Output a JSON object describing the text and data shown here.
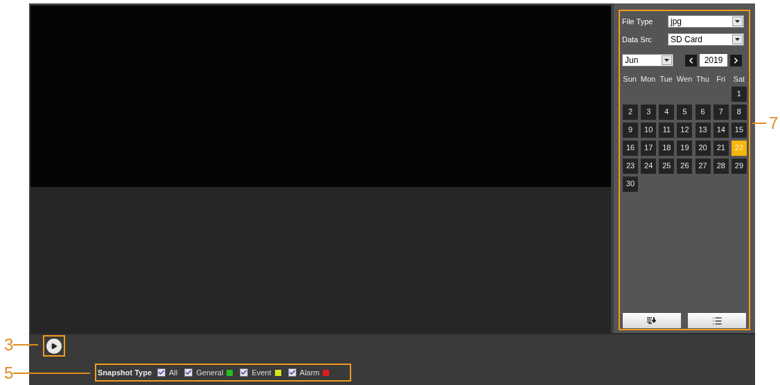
{
  "player": {
    "callout": "3"
  },
  "snapshot_filter": {
    "callout": "5",
    "label": "Snapshot Type",
    "types": [
      {
        "label": "All",
        "checked": true
      },
      {
        "label": "General",
        "checked": true,
        "color": "#22c021"
      },
      {
        "label": "Event",
        "checked": true,
        "color": "#d6e81c"
      },
      {
        "label": "Alarm",
        "checked": true,
        "color": "#e21b1b"
      }
    ]
  },
  "side_panel": {
    "callout": "7",
    "fields": [
      {
        "label": "File Type",
        "value": "jpg"
      },
      {
        "label": "Data Src",
        "value": "SD Card"
      }
    ],
    "month": "Jun",
    "year": "2019",
    "weekdays": [
      "Sun",
      "Mon",
      "Tue",
      "Wen",
      "Thu",
      "Fri",
      "Sat"
    ],
    "weeks": [
      {
        "kind": "first",
        "days": [
          {
            "label": "1",
            "selected": false
          }
        ]
      },
      {
        "kind": "full",
        "days": [
          {
            "label": "2",
            "selected": false
          },
          {
            "label": "3",
            "selected": false
          },
          {
            "label": "4",
            "selected": false
          },
          {
            "label": "5",
            "selected": false
          },
          {
            "label": "6",
            "selected": false
          },
          {
            "label": "7",
            "selected": false
          },
          {
            "label": "8",
            "selected": false
          }
        ]
      },
      {
        "kind": "full",
        "days": [
          {
            "label": "9",
            "selected": false
          },
          {
            "label": "10",
            "selected": false
          },
          {
            "label": "11",
            "selected": false
          },
          {
            "label": "12",
            "selected": false
          },
          {
            "label": "13",
            "selected": false
          },
          {
            "label": "14",
            "selected": false
          },
          {
            "label": "15",
            "selected": false
          }
        ]
      },
      {
        "kind": "full",
        "days": [
          {
            "label": "16",
            "selected": false
          },
          {
            "label": "17",
            "selected": false
          },
          {
            "label": "18",
            "selected": false
          },
          {
            "label": "19",
            "selected": false
          },
          {
            "label": "20",
            "selected": false
          },
          {
            "label": "21",
            "selected": false
          },
          {
            "label": "22",
            "selected": true
          }
        ]
      },
      {
        "kind": "full",
        "days": [
          {
            "label": "23",
            "selected": false
          },
          {
            "label": "24",
            "selected": false
          },
          {
            "label": "25",
            "selected": false
          },
          {
            "label": "26",
            "selected": false
          },
          {
            "label": "27",
            "selected": false
          },
          {
            "label": "28",
            "selected": false
          },
          {
            "label": "29",
            "selected": false
          }
        ]
      },
      {
        "kind": "last",
        "days": [
          {
            "label": "30",
            "selected": false
          }
        ]
      }
    ]
  }
}
